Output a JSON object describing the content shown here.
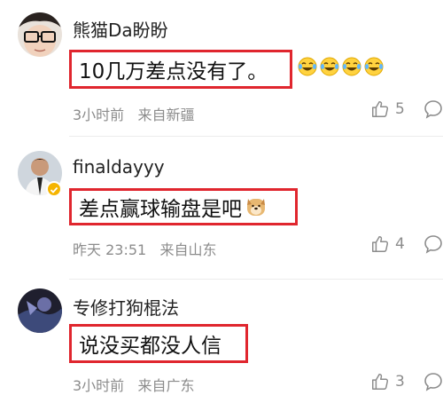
{
  "comments": [
    {
      "username": "熊猫Da盼盼",
      "text": "10几万差点没有了。",
      "emoji": [
        "laugh-cry",
        "laugh-cry",
        "laugh-cry",
        "laugh-cry"
      ],
      "time": "3小时前",
      "location": "来自新疆",
      "likes": "5"
    },
    {
      "username": "finaldayyy",
      "verified": true,
      "text": "差点赢球输盘是吧",
      "emoji": [
        "doge"
      ],
      "time": "昨天 23:51",
      "location": "来自山东",
      "likes": "4"
    },
    {
      "username": "专修打狗棍法",
      "text": "说没买都没人信",
      "time": "3小时前",
      "location": "来自广东",
      "likes": "3"
    }
  ],
  "colors": {
    "highlight_border": "#e0262e",
    "meta_text": "#8c8c8c",
    "verified_badge": "#f5b400"
  },
  "icons": {
    "like": "thumbs-up-icon",
    "reply": "comment-bubble-icon"
  }
}
